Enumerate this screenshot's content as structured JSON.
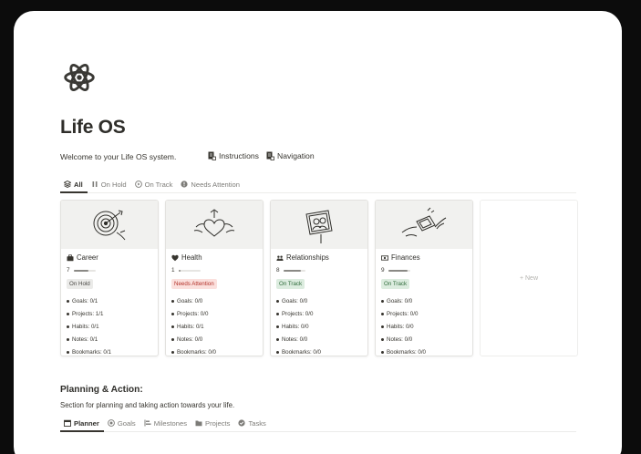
{
  "page": {
    "title": "Life OS",
    "welcome": "Welcome to your Life OS system."
  },
  "links": {
    "instructions": "Instructions",
    "navigation": "Navigation"
  },
  "views": [
    "All",
    "On Hold",
    "On Track",
    "Needs Attention"
  ],
  "cards": [
    {
      "name": "Career",
      "count": "7",
      "progress": 0.7,
      "status": "On Hold",
      "items": [
        "Goals: 0/1",
        "Projects: 1/1",
        "Habits: 0/1",
        "Notes: 0/1",
        "Bookmarks: 0/1"
      ]
    },
    {
      "name": "Health",
      "count": "1",
      "progress": 0.1,
      "status": "Needs Attention",
      "items": [
        "Goals: 0/0",
        "Projects: 0/0",
        "Habits: 0/1",
        "Notes: 0/0",
        "Bookmarks: 0/0"
      ]
    },
    {
      "name": "Relationships",
      "count": "8",
      "progress": 0.8,
      "status": "On Track",
      "items": [
        "Goals: 0/0",
        "Projects: 0/0",
        "Habits: 0/0",
        "Notes: 0/0",
        "Bookmarks: 0/0"
      ]
    },
    {
      "name": "Finances",
      "count": "9",
      "progress": 0.9,
      "status": "On Track",
      "items": [
        "Goals: 0/0",
        "Projects: 0/0",
        "Habits: 0/0",
        "Notes: 0/0",
        "Bookmarks: 0/0"
      ]
    }
  ],
  "new_label": "+ New",
  "planning": {
    "title": "Planning & Action:",
    "subtitle": "Section for planning and taking action towards your life.",
    "views": [
      "Planner",
      "Goals",
      "Milestones",
      "Projects",
      "Tasks"
    ]
  }
}
